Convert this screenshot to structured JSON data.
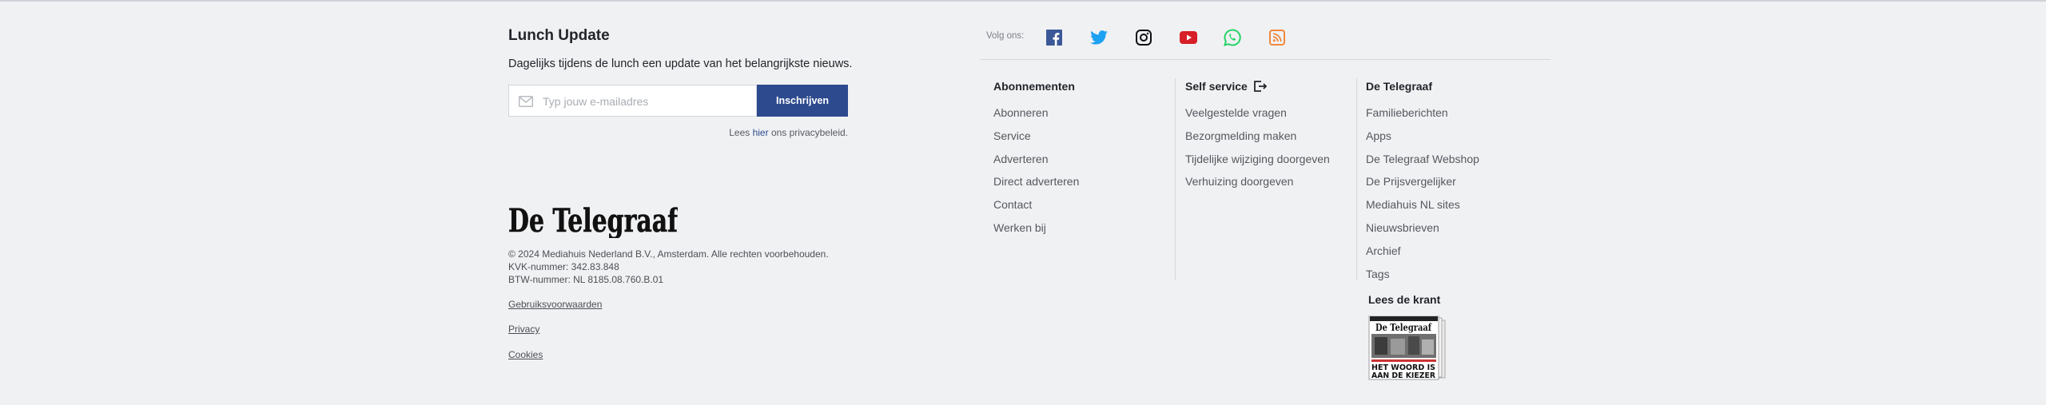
{
  "newsletter": {
    "title": "Lunch Update",
    "description": "Dagelijks tijdens de lunch een update van het belangrijkste nieuws.",
    "email_placeholder": "Typ jouw e-mailadres",
    "subscribe_label": "Inschrijven",
    "privacy_prefix": "Lees ",
    "privacy_link": "hier",
    "privacy_suffix": " ons privacybeleid."
  },
  "brand": {
    "logo_text": "De Telegraaf",
    "copyright": "© 2024 Mediahuis Nederland B.V., Amsterdam. Alle rechten voorbehouden.",
    "kvk": "KVK-nummer: 342.83.848",
    "btw": "BTW-nummer: NL 8185.08.760.B.01"
  },
  "legal_links": [
    "Gebruiksvoorwaarden",
    "Privacy",
    "Cookies"
  ],
  "social": {
    "label": "Volg ons:",
    "icons": [
      "facebook-icon",
      "twitter-icon",
      "instagram-icon",
      "youtube-icon",
      "whatsapp-icon",
      "rss-icon"
    ],
    "colors": {
      "facebook": "#3b5998",
      "twitter": "#1da1f2",
      "instagram": "#111111",
      "youtube": "#d61f26",
      "whatsapp": "#25d366",
      "rss": "#f0883e"
    }
  },
  "columns": [
    {
      "heading": "Abonnementen",
      "links": [
        "Abonneren",
        "Service",
        "Adverteren",
        "Direct adverteren",
        "Contact",
        "Werken bij"
      ]
    },
    {
      "heading": "Self service",
      "heading_icon": "logout-icon",
      "links": [
        "Veelgestelde vragen",
        "Bezorgmelding maken",
        "Tijdelijke wijziging doorgeven",
        "Verhuizing doorgeven"
      ]
    },
    {
      "heading": "De Telegraaf",
      "links": [
        "Familieberichten",
        "Apps",
        "De Telegraaf Webshop",
        "De Prijsvergelijker",
        "Mediahuis NL sites",
        "Nieuwsbrieven",
        "Archief",
        "Tags"
      ]
    }
  ],
  "krant": {
    "heading": "Lees de krant",
    "thumb_masthead": "De Telegraaf",
    "thumb_headline_1": "HET WOORD IS",
    "thumb_headline_2": "AAN DE KIEZER"
  },
  "colors": {
    "accent": "#2d4a8e",
    "background": "#f0f1f3"
  }
}
